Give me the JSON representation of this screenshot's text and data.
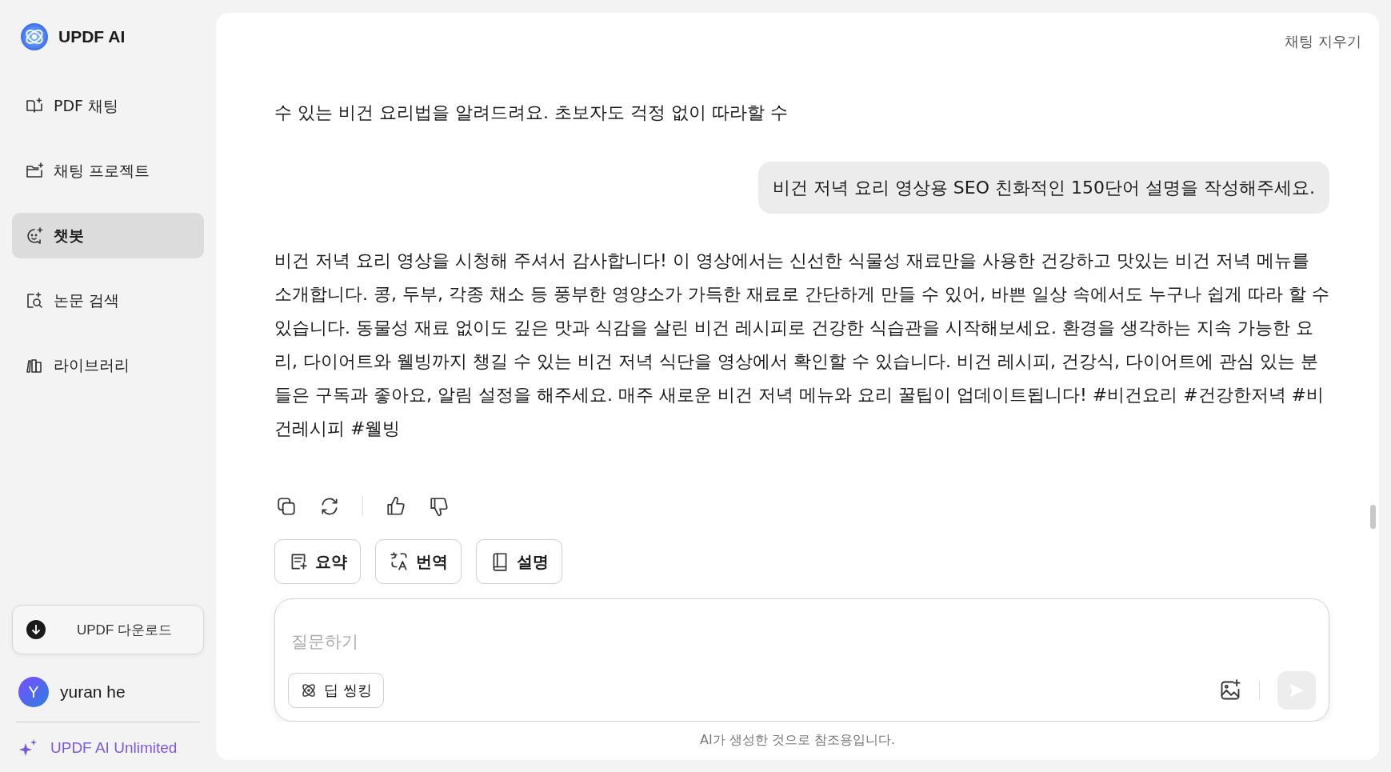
{
  "sidebar": {
    "brand": "UPDF AI",
    "items": [
      {
        "label": "PDF 채팅",
        "selected": false
      },
      {
        "label": "채팅 프로젝트",
        "selected": false
      },
      {
        "label": "챗봇",
        "selected": true
      },
      {
        "label": "논문 검색",
        "selected": false
      },
      {
        "label": "라이브러리",
        "selected": false
      }
    ],
    "download_button": "UPDF 다운로드",
    "user": {
      "initial": "Y",
      "name": "yuran he"
    },
    "plan_link": "UPDF AI Unlimited"
  },
  "main": {
    "clear_button": "채팅 지우기",
    "messages": [
      {
        "kind": "assistant",
        "text": "수 있는 비건 요리법을 알려드려요. 초보자도 걱정 없이 따라할 수"
      },
      {
        "kind": "user",
        "text": "비건 저녁 요리 영상용 SEO 친화적인 150단어 설명을 작성해주세요."
      },
      {
        "kind": "assistant",
        "text": "비건 저녁 요리 영상을 시청해 주셔서 감사합니다! 이 영상에서는 신선한 식물성 재료만을 사용한 건강하고 맛있는 비건 저녁 메뉴를 소개합니다. 콩, 두부, 각종 채소 등 풍부한 영양소가 가득한 재료로 간단하게 만들 수 있어, 바쁜 일상 속에서도 누구나 쉽게 따라 할 수 있습니다. 동물성 재료 없이도 깊은 맛과 식감을 살린 비건 레시피로 건강한 식습관을 시작해보세요. 환경을 생각하는 지속 가능한 요리, 다이어트와 웰빙까지 챙길 수 있는 비건 저녁 식단을 영상에서 확인할 수 있습니다. 비건 레시피, 건강식, 다이어트에 관심 있는 분들은 구독과 좋아요, 알림 설정을 해주세요. 매주 새로운 비건 저녁 메뉴와 요리 꿀팁이 업데이트됩니다! #비건요리 #건강한저녁 #비건레시피 #웰빙"
      }
    ],
    "quick_actions": [
      {
        "label": "요약"
      },
      {
        "label": "번역"
      },
      {
        "label": "설명"
      }
    ],
    "input": {
      "placeholder": "질문하기",
      "deep_think_button": "딥 씽킹",
      "send_disabled": true
    },
    "disclaimer": "AI가 생성한 것으로 참조용입니다."
  }
}
